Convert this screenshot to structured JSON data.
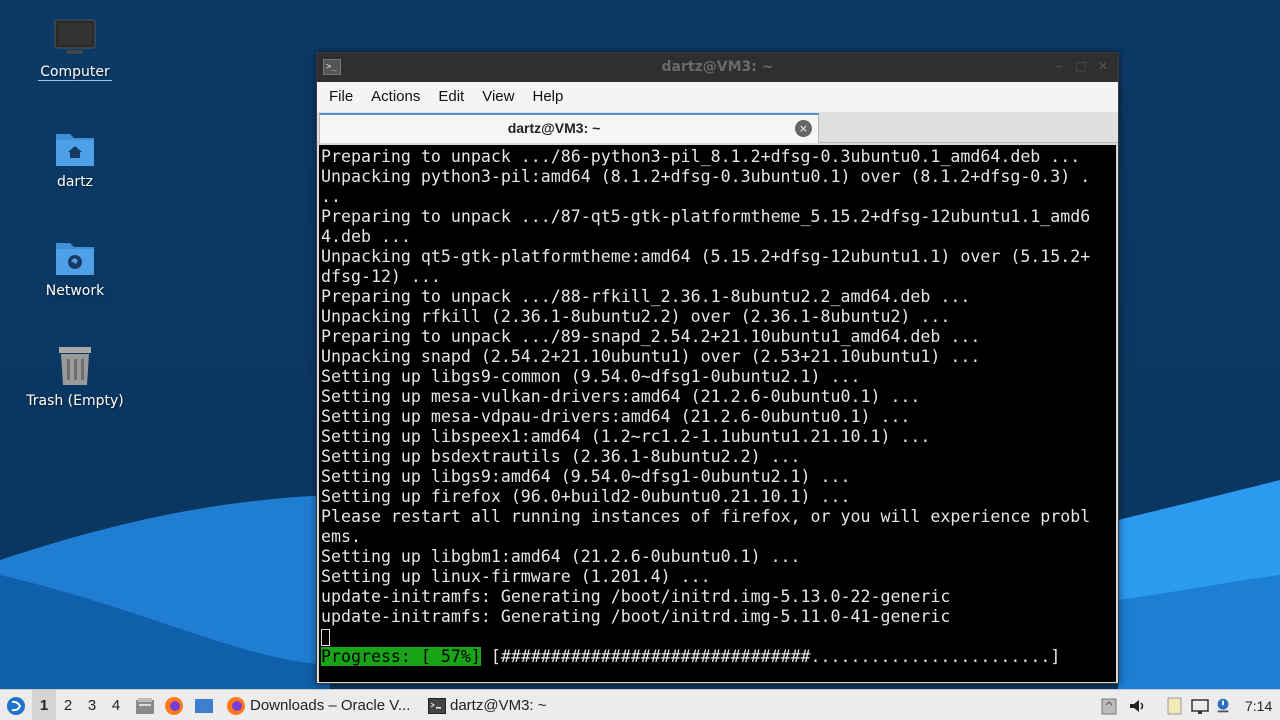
{
  "desktop": {
    "icons": [
      {
        "label": "Computer",
        "icon": "computer-icon"
      },
      {
        "label": "dartz",
        "icon": "home-folder-icon"
      },
      {
        "label": "Network",
        "icon": "network-folder-icon"
      },
      {
        "label": "Trash (Empty)",
        "icon": "trash-icon"
      }
    ]
  },
  "window": {
    "title": "dartz@VM3: ~",
    "menu": [
      "File",
      "Actions",
      "Edit",
      "View",
      "Help"
    ],
    "tab_label": "dartz@VM3: ~",
    "close_glyph": "×"
  },
  "terminal": {
    "lines": [
      "Preparing to unpack .../86-python3-pil_8.1.2+dfsg-0.3ubuntu0.1_amd64.deb ...",
      "Unpacking python3-pil:amd64 (8.1.2+dfsg-0.3ubuntu0.1) over (8.1.2+dfsg-0.3) .",
      "..",
      "Preparing to unpack .../87-qt5-gtk-platformtheme_5.15.2+dfsg-12ubuntu1.1_amd6",
      "4.deb ...",
      "Unpacking qt5-gtk-platformtheme:amd64 (5.15.2+dfsg-12ubuntu1.1) over (5.15.2+",
      "dfsg-12) ...",
      "Preparing to unpack .../88-rfkill_2.36.1-8ubuntu2.2_amd64.deb ...",
      "Unpacking rfkill (2.36.1-8ubuntu2.2) over (2.36.1-8ubuntu2) ...",
      "Preparing to unpack .../89-snapd_2.54.2+21.10ubuntu1_amd64.deb ...",
      "Unpacking snapd (2.54.2+21.10ubuntu1) over (2.53+21.10ubuntu1) ...",
      "Setting up libgs9-common (9.54.0~dfsg1-0ubuntu2.1) ...",
      "Setting up mesa-vulkan-drivers:amd64 (21.2.6-0ubuntu0.1) ...",
      "Setting up mesa-vdpau-drivers:amd64 (21.2.6-0ubuntu0.1) ...",
      "Setting up libspeex1:amd64 (1.2~rc1.2-1.1ubuntu1.21.10.1) ...",
      "Setting up bsdextrautils (2.36.1-8ubuntu2.2) ...",
      "Setting up libgs9:amd64 (9.54.0~dfsg1-0ubuntu2.1) ...",
      "Setting up firefox (96.0+build2-0ubuntu0.21.10.1) ...",
      "Please restart all running instances of firefox, or you will experience probl",
      "ems.",
      "Setting up libgbm1:amd64 (21.2.6-0ubuntu0.1) ...",
      "Setting up linux-firmware (1.201.4) ...",
      "update-initramfs: Generating /boot/initrd.img-5.13.0-22-generic",
      "update-initramfs: Generating /boot/initrd.img-5.11.0-41-generic"
    ],
    "progress_label": "Progress: [ 57%]",
    "progress_bar": "[###############################........................]",
    "progress_fraction": 0.57
  },
  "taskbar": {
    "workspaces": [
      "1",
      "2",
      "3",
      "4"
    ],
    "active_workspace": "1",
    "tasks": [
      {
        "label": "Downloads – Oracle V...",
        "icon": "firefox-icon"
      },
      {
        "label": "dartz@VM3: ~",
        "icon": "terminal-icon"
      }
    ],
    "clock": "7:14"
  },
  "colors": {
    "wallpaper_top": "#0b3a66",
    "wave_light": "#1e7fd6",
    "wave_bright": "#2b9bf0",
    "progress_green": "#19a319",
    "tab_accent": "#5b8fd4"
  }
}
